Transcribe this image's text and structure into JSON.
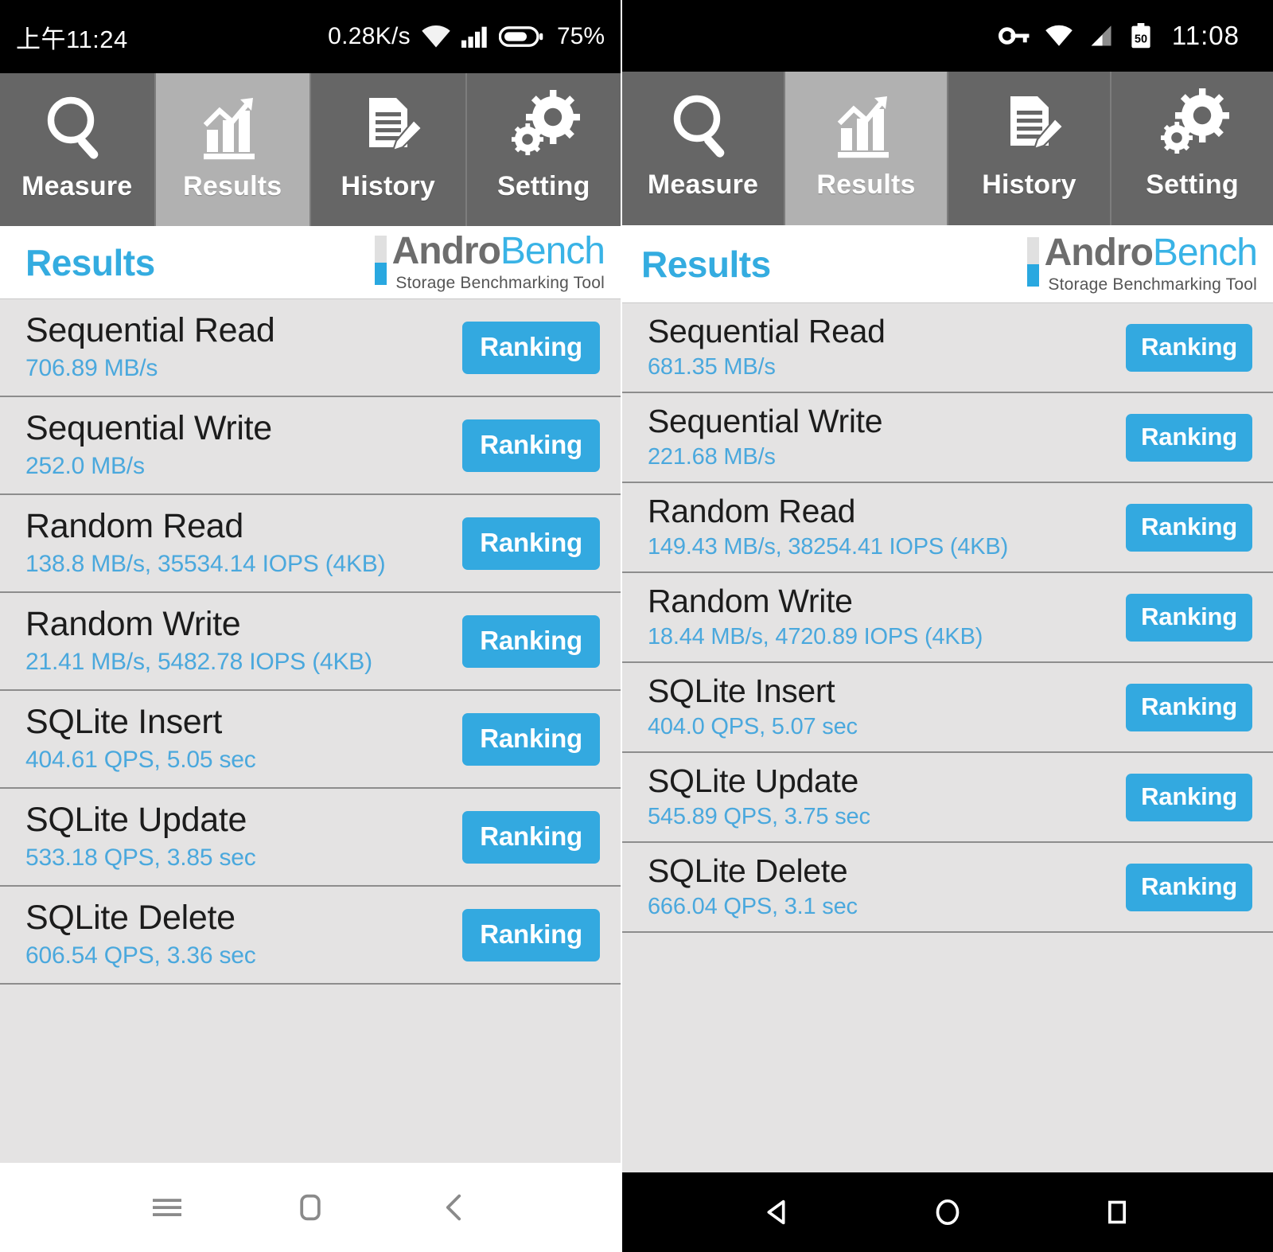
{
  "left_phone": {
    "status_bar": {
      "clock": "上午11:24",
      "net_speed": "0.28K/s",
      "wifi_icon": "wifi-icon",
      "signal_icon": "cellular-signal-icon",
      "battery_icon": "battery-icon",
      "battery_percent": "75%"
    },
    "tabs": [
      {
        "label": "Measure",
        "icon": "magnifier-icon",
        "selected": false
      },
      {
        "label": "Results",
        "icon": "bar-chart-arrow-icon",
        "selected": true
      },
      {
        "label": "History",
        "icon": "document-pencil-icon",
        "selected": false
      },
      {
        "label": "Setting",
        "icon": "gears-icon",
        "selected": false
      }
    ],
    "header": {
      "title": "Results",
      "logo_primary": "Andro",
      "logo_secondary": "Bench",
      "logo_tagline": "Storage Benchmarking Tool"
    },
    "rows": [
      {
        "title": "Sequential Read",
        "value": "706.89 MB/s",
        "button": "Ranking"
      },
      {
        "title": "Sequential Write",
        "value": "252.0 MB/s",
        "button": "Ranking"
      },
      {
        "title": "Random Read",
        "value": "138.8 MB/s, 35534.14 IOPS (4KB)",
        "button": "Ranking"
      },
      {
        "title": "Random Write",
        "value": "21.41 MB/s, 5482.78 IOPS (4KB)",
        "button": "Ranking"
      },
      {
        "title": "SQLite Insert",
        "value": "404.61 QPS, 5.05 sec",
        "button": "Ranking"
      },
      {
        "title": "SQLite Update",
        "value": "533.18 QPS, 3.85 sec",
        "button": "Ranking"
      },
      {
        "title": "SQLite Delete",
        "value": "606.54 QPS, 3.36 sec",
        "button": "Ranking"
      }
    ],
    "nav_bar": {
      "menu_icon": "menu-icon",
      "home_icon": "home-rounded-square-icon",
      "back_icon": "back-chevron-icon"
    }
  },
  "right_phone": {
    "status_bar": {
      "vpn_key_icon": "vpn-key-icon",
      "wifi_icon": "wifi-icon",
      "signal_icon": "cellular-signal-icon",
      "battery_icon": "battery-icon",
      "battery_level": "50",
      "clock": "11:08"
    },
    "tabs": [
      {
        "label": "Measure",
        "icon": "magnifier-icon",
        "selected": false
      },
      {
        "label": "Results",
        "icon": "bar-chart-arrow-icon",
        "selected": true
      },
      {
        "label": "History",
        "icon": "document-pencil-icon",
        "selected": false
      },
      {
        "label": "Setting",
        "icon": "gears-icon",
        "selected": false
      }
    ],
    "header": {
      "title": "Results",
      "logo_primary": "Andro",
      "logo_secondary": "Bench",
      "logo_tagline": "Storage Benchmarking Tool"
    },
    "rows": [
      {
        "title": "Sequential Read",
        "value": "681.35 MB/s",
        "button": "Ranking"
      },
      {
        "title": "Sequential Write",
        "value": "221.68 MB/s",
        "button": "Ranking"
      },
      {
        "title": "Random Read",
        "value": "149.43 MB/s, 38254.41 IOPS (4KB)",
        "button": "Ranking"
      },
      {
        "title": "Random Write",
        "value": "18.44 MB/s, 4720.89 IOPS (4KB)",
        "button": "Ranking"
      },
      {
        "title": "SQLite Insert",
        "value": "404.0 QPS, 5.07 sec",
        "button": "Ranking"
      },
      {
        "title": "SQLite Update",
        "value": "545.89 QPS, 3.75 sec",
        "button": "Ranking"
      },
      {
        "title": "SQLite Delete",
        "value": "666.04 QPS, 3.1 sec",
        "button": "Ranking"
      }
    ],
    "nav_bar": {
      "back_icon": "back-triangle-icon",
      "home_icon": "home-circle-icon",
      "recents_icon": "recents-square-icon"
    }
  },
  "colors": {
    "accent_blue": "#33a9e0",
    "tab_unselected": "#666666",
    "tab_selected": "#b1b1b1",
    "list_background": "#e4e3e3",
    "logo_gray": "#6d6d6d"
  }
}
